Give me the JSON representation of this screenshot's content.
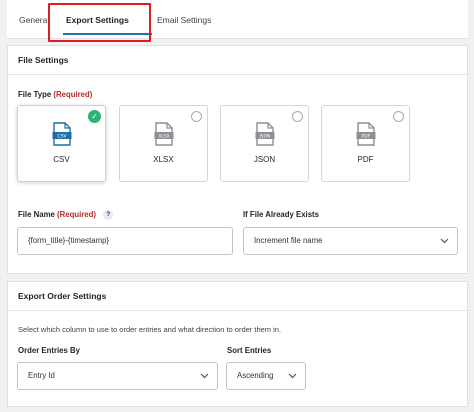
{
  "tabs": [
    {
      "label": "General"
    },
    {
      "label": "Export Settings"
    },
    {
      "label": "Email Settings"
    }
  ],
  "file_settings": {
    "title": "File Settings",
    "file_type_label": "File Type",
    "required": "(Required)",
    "types": [
      {
        "name": "CSV",
        "icon_text": "CSV",
        "selected": true
      },
      {
        "name": "XLSX",
        "icon_text": "XLSX",
        "selected": false
      },
      {
        "name": "JSON",
        "icon_text": "JSON",
        "selected": false
      },
      {
        "name": "PDF",
        "icon_text": "PDF",
        "selected": false
      }
    ],
    "file_name_label": "File Name",
    "file_name_help": "?",
    "file_name_value": "{form_title}-{timestamp}",
    "exists_label": "If File Already Exists",
    "exists_value": "Increment file name"
  },
  "order_settings": {
    "title": "Export Order Settings",
    "description": "Select which column to use to order entries and what direction to order them in.",
    "order_by_label": "Order Entries By",
    "order_by_value": "Entry Id",
    "sort_label": "Sort Entries",
    "sort_value": "Ascending"
  },
  "colors": {
    "accent": "#2271b1",
    "selected_check": "#29b473",
    "icon_color": "#1e6fa8",
    "icon_muted": "#8c8f94",
    "required": "#b32d2e",
    "highlight": "#e11b22"
  }
}
